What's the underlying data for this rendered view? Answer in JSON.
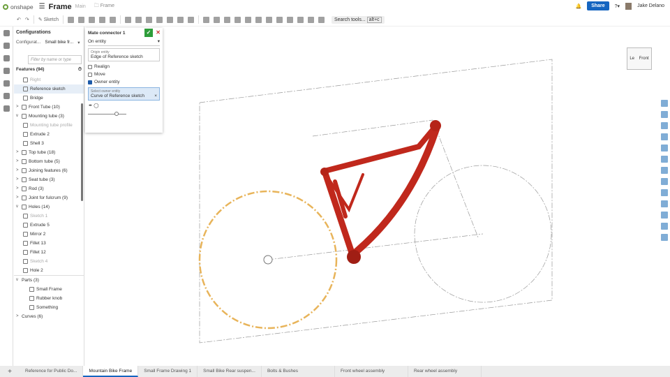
{
  "header": {
    "app": "onshape",
    "title": "Frame",
    "branch": "Main",
    "folder": "Frame",
    "share": "Share",
    "user": "Jake Delano"
  },
  "toolbar": {
    "sketch": "Sketch",
    "search": "Search tools...",
    "shortcut": "alt+c"
  },
  "panel": {
    "title": "Configurations",
    "config_label": "Configurat...",
    "config_value": "Small bike fr...",
    "filter_placeholder": "Filter by name or type",
    "features_title": "Features (94)",
    "features": [
      {
        "label": "Right",
        "state": "dim",
        "caret": ""
      },
      {
        "label": "Reference sketch",
        "state": "sel",
        "caret": ""
      },
      {
        "label": "Bridge",
        "state": "",
        "caret": ""
      },
      {
        "label": "Front Tube (10)",
        "state": "",
        "caret": ">"
      },
      {
        "label": "Mounting tube (3)",
        "state": "",
        "caret": "v"
      },
      {
        "label": "Mounting tube profile",
        "state": "dim",
        "caret": ""
      },
      {
        "label": "Extrude 2",
        "state": "",
        "caret": ""
      },
      {
        "label": "Shell 3",
        "state": "",
        "caret": ""
      },
      {
        "label": "Top tube (18)",
        "state": "",
        "caret": ">"
      },
      {
        "label": "Bottom tube (5)",
        "state": "",
        "caret": ">"
      },
      {
        "label": "Joining features (6)",
        "state": "",
        "caret": ">"
      },
      {
        "label": "Seat tube (3)",
        "state": "",
        "caret": ">"
      },
      {
        "label": "Rod (3)",
        "state": "",
        "caret": ">"
      },
      {
        "label": "Joint for fulcrum (9)",
        "state": "",
        "caret": ">"
      },
      {
        "label": "Holes (14)",
        "state": "",
        "caret": "v"
      },
      {
        "label": "Sketch 1",
        "state": "dim",
        "caret": ""
      },
      {
        "label": "Extrude 5",
        "state": "",
        "caret": ""
      },
      {
        "label": "Mirror 2",
        "state": "",
        "caret": ""
      },
      {
        "label": "Fillet 13",
        "state": "",
        "caret": ""
      },
      {
        "label": "Fillet 12",
        "state": "",
        "caret": ""
      },
      {
        "label": "Sketch 4",
        "state": "dim",
        "caret": ""
      },
      {
        "label": "Hole 2",
        "state": "",
        "caret": ""
      }
    ],
    "parts_title": "Parts (3)",
    "parts": [
      "Small Frame",
      "Rubber knob",
      "Something"
    ],
    "curves": "Curves (6)"
  },
  "dialog": {
    "title": "Mate connector 1",
    "mode": "On entity",
    "origin_label": "Origin entity",
    "origin_value": "Edge of Reference sketch",
    "realign": "Realign",
    "move": "Move",
    "owner": "Owner entity",
    "owner_label": "Select owner entity",
    "owner_value": "Curve of Reference sketch"
  },
  "viewcube": {
    "front": "Front",
    "left": "Le"
  },
  "tabs": [
    "Reference for Public Do...",
    "Mountain Bike Frame",
    "Small Frame Drawing 1",
    "Small Bike Rear suspen...",
    "Bolts & Bushes",
    "Front wheel assembly",
    "Rear wheel assembly"
  ],
  "colors": {
    "accent": "#1565c0",
    "frame": "#c0281c",
    "wheel": "#e8b45a",
    "ok": "#2e9d3a"
  }
}
